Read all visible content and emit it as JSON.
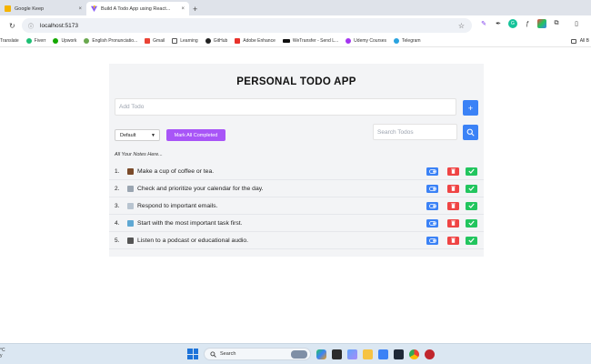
{
  "browser": {
    "tabs": [
      {
        "label": "Google Keep",
        "active": false
      },
      {
        "label": "Build A Todo App using React...",
        "active": true
      }
    ],
    "new_tab_symbol": "+",
    "close_symbol": "×",
    "url": "localhost:5173",
    "bookmarks": [
      "Translate",
      "Fiverr",
      "Upwork",
      "English Pronunciatio...",
      "Gmail",
      "Learning",
      "GitHub",
      "Adobe Enhance",
      "WeTransfer - Send L...",
      "Udemy Courses",
      "Telegram"
    ],
    "bookmarks_right": "All B"
  },
  "app": {
    "title": "PERSONAL TODO APP",
    "add_placeholder": "Add Todo",
    "add_button_label": "+",
    "filter_selected": "Default",
    "mark_all_label": "Mark All Completed",
    "search_placeholder": "Search Todos",
    "notes_label": "All Your Notes Here...",
    "todos": [
      {
        "number": "1.",
        "text": "Make a cup of coffee or tea.",
        "icon": "coffee-icon",
        "icon_color": "#7a4a2a"
      },
      {
        "number": "2.",
        "text": "Check and prioritize your calendar for the day.",
        "icon": "calendar-icon",
        "icon_color": "#9aa5b1"
      },
      {
        "number": "3.",
        "text": "Respond to important emails.",
        "icon": "email-icon",
        "icon_color": "#b8c4d0"
      },
      {
        "number": "4.",
        "text": "Start with the most important task first.",
        "icon": "clipboard-icon",
        "icon_color": "#5fa8d3"
      },
      {
        "number": "5.",
        "text": "Listen to a podcast or educational audio.",
        "icon": "headphones-icon",
        "icon_color": "#555555"
      }
    ],
    "colors": {
      "primary": "#3b82f6",
      "danger": "#ef4444",
      "success": "#22c55e",
      "purple": "#a855f7"
    }
  },
  "taskbar": {
    "weather_line1": "°C",
    "weather_line2": "y",
    "search_label": "Search"
  }
}
